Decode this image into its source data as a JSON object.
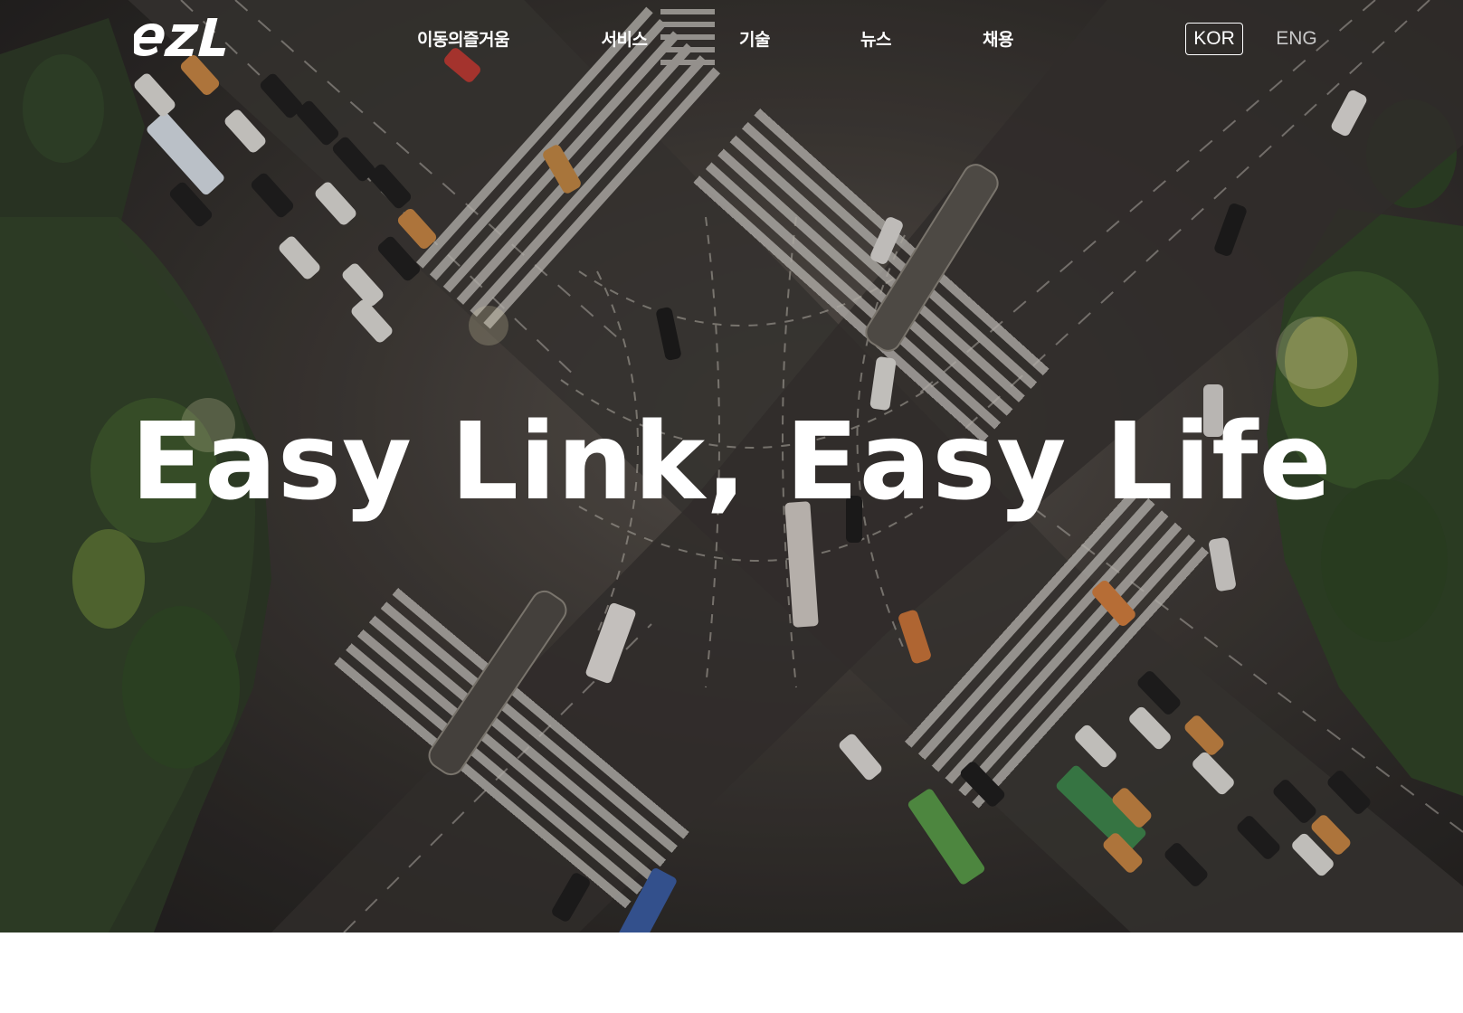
{
  "brand": {
    "logo_text": "ezl",
    "logo_color": "#ffffff"
  },
  "nav": {
    "items": [
      {
        "label": "이동의즐거움"
      },
      {
        "label": "서비스"
      },
      {
        "label": "기술"
      },
      {
        "label": "뉴스"
      },
      {
        "label": "채용"
      }
    ]
  },
  "language": {
    "active": "KOR",
    "other": "ENG"
  },
  "hero": {
    "headline": "Easy Link, Easy Life",
    "background": "aerial night view of a city intersection with crosswalks and traffic",
    "text_color": "#ffffff"
  }
}
